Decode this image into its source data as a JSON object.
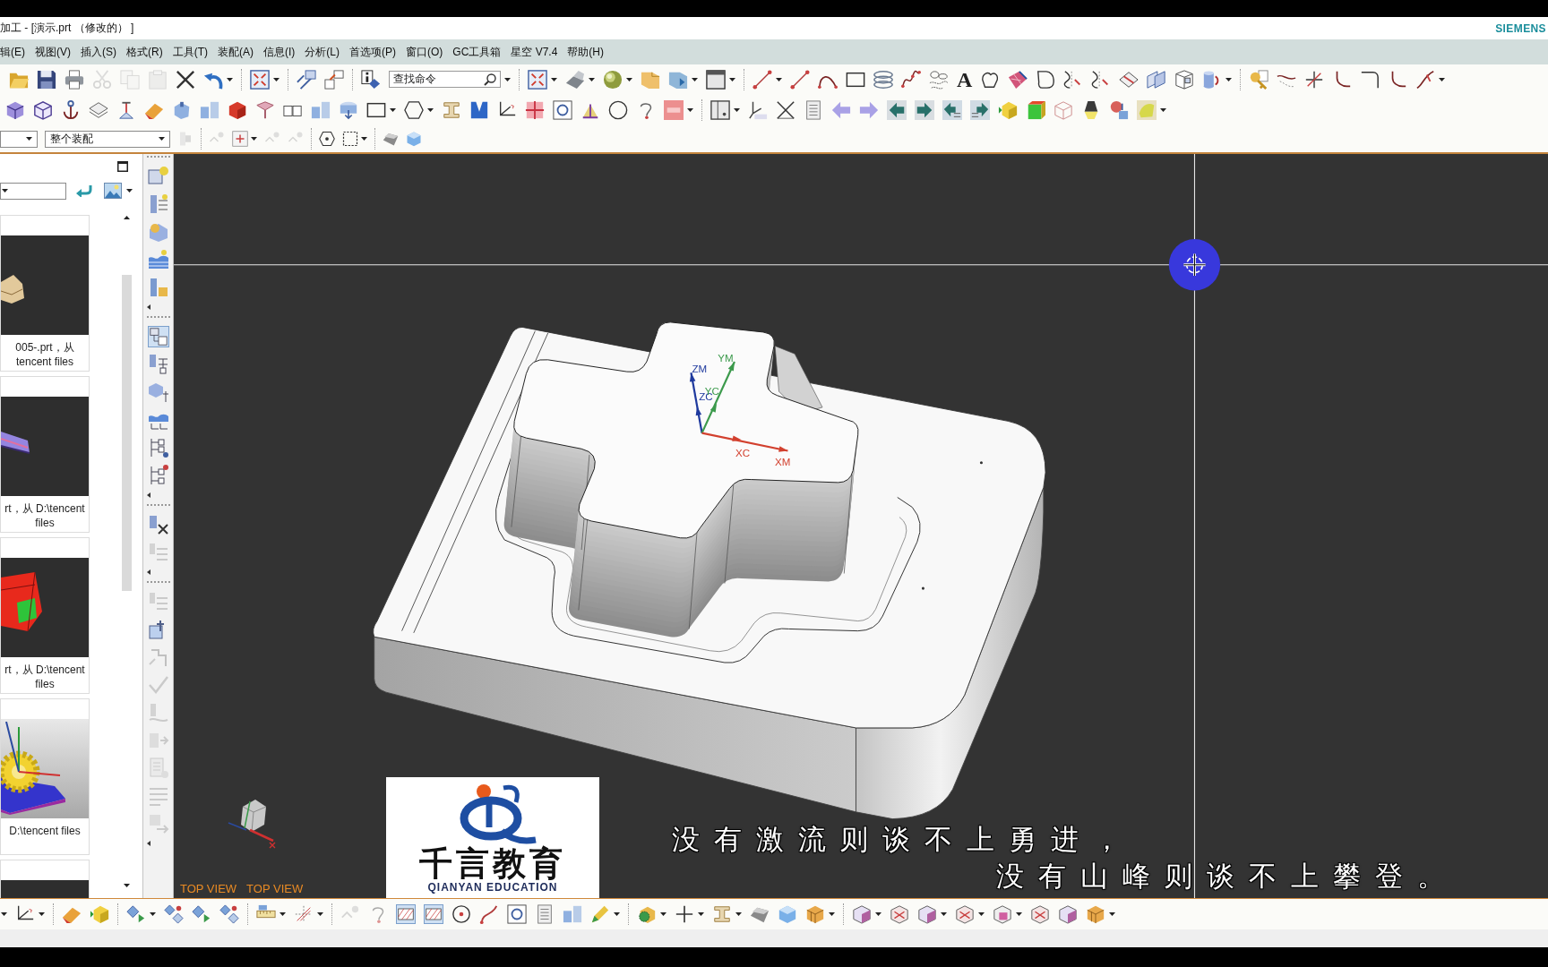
{
  "window": {
    "title": "加工 - [演示.prt （修改的） ]",
    "brand": "SIEMENS"
  },
  "menu": [
    "辑(E)",
    "视图(V)",
    "插入(S)",
    "格式(R)",
    "工具(T)",
    "装配(A)",
    "信息(I)",
    "分析(L)",
    "首选项(P)",
    "窗口(O)",
    "GC工具箱",
    "星空 V7.4",
    "帮助(H)"
  ],
  "toolbar": {
    "search": {
      "placeholder": "查找命令"
    },
    "text_tool": "A"
  },
  "selection_bar": {
    "scope": {
      "value": "整个装配"
    }
  },
  "history_panel": {
    "items": [
      {
        "kind": "bracket",
        "caption": "005-.prt，从\ntencent files"
      },
      {
        "kind": "slab",
        "caption": "rt，从 D:\\tencent\nfiles"
      },
      {
        "kind": "housing",
        "caption": "rt，从 D:\\tencent\nfiles"
      },
      {
        "kind": "gear",
        "caption": "D:\\tencent files"
      },
      {
        "kind": "dark"
      }
    ]
  },
  "side_toolbar": {
    "toggles": [
      {
        "selected": true
      },
      {
        "selected": false
      },
      {
        "selected": false
      },
      {
        "selected": false
      }
    ]
  },
  "viewport": {
    "csys": {
      "axes": [
        {
          "kind": "z",
          "color": "#1f3a9e",
          "labels": [
            "ZM",
            "ZC"
          ]
        },
        {
          "kind": "y",
          "color": "#3c9a4c",
          "labels": [
            "YM",
            "YC"
          ]
        },
        {
          "kind": "x",
          "color": "#d2402e",
          "labels": [
            "XC",
            "XM"
          ]
        }
      ]
    },
    "view_labels": [
      "TOP VIEW",
      "TOP VIEW"
    ],
    "logo": {
      "title": "千言教育",
      "subtitle": "QIANYAN EDUCATION"
    },
    "subtitles": [
      "没有激流则谈不上勇进，",
      "没有山峰则谈不上攀登。"
    ]
  },
  "bottom_toolbar": {
    "toggles": [
      {
        "selected": true
      },
      {
        "selected": true
      }
    ]
  }
}
